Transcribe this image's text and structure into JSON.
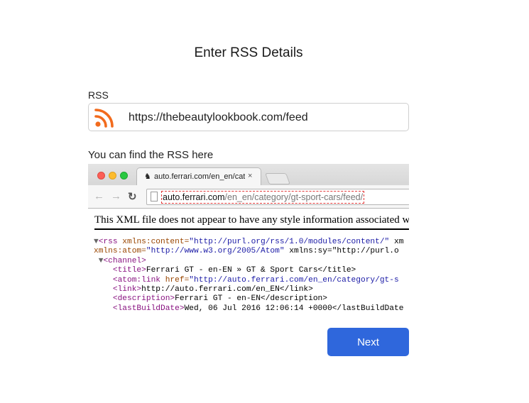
{
  "page": {
    "title": "Enter RSS Details",
    "rss_label": "RSS",
    "rss_value": "https://thebeautylookbook.com/feed",
    "hint": "You can find the RSS here",
    "next_label": "Next"
  },
  "browser": {
    "tab_title": "auto.ferrari.com/en_en/cate",
    "tab_close": "×",
    "url_host": "auto.ferrari.com",
    "url_path": "/en_en/category/gt-sport-cars/feed/",
    "xml_notice": "This XML file does not appear to have any style information associated with it",
    "xml_lines": [
      {
        "arrow": "▼",
        "tag_open": "<rss ",
        "attr": "xmlns:content=",
        "val": "\"http://purl.org/rss/1.0/modules/content/\"",
        "rest": " xm"
      },
      {
        "arrow": "",
        "tag_open": "",
        "attr": "xmlns:atom=",
        "val": "\"http://www.w3.org/2005/Atom\"",
        "rest": " xmlns:sy=\"http://purl.o"
      },
      {
        "arrow": " ▼",
        "tag_open": "<channel>",
        "attr": "",
        "val": "",
        "rest": ""
      },
      {
        "arrow": "    ",
        "tag_open": "<title>",
        "attr": "",
        "val": "",
        "rest": "Ferrari GT - en-EN » GT & Sport Cars</title>"
      },
      {
        "arrow": "    ",
        "tag_open": "<atom:link ",
        "attr": "href=",
        "val": "\"http://auto.ferrari.com/en_en/category/gt-s",
        "rest": ""
      },
      {
        "arrow": "    ",
        "tag_open": "<link>",
        "attr": "",
        "val": "",
        "rest": "http://auto.ferrari.com/en_EN</link>"
      },
      {
        "arrow": "    ",
        "tag_open": "<description>",
        "attr": "",
        "val": "",
        "rest": "Ferrari GT - en-EN</description>"
      },
      {
        "arrow": "    ",
        "tag_open": "<lastBuildDate>",
        "attr": "",
        "val": "",
        "rest": "Wed, 06 Jul 2016 12:06:14 +0000</lastBuildDate"
      }
    ]
  },
  "icons": {
    "rss": "rss-feed-icon",
    "back": "back-arrow-icon",
    "forward": "forward-arrow-icon",
    "reload": "reload-icon"
  },
  "colors": {
    "primary": "#2f67dc",
    "rss_orange": "#f26b1d"
  }
}
